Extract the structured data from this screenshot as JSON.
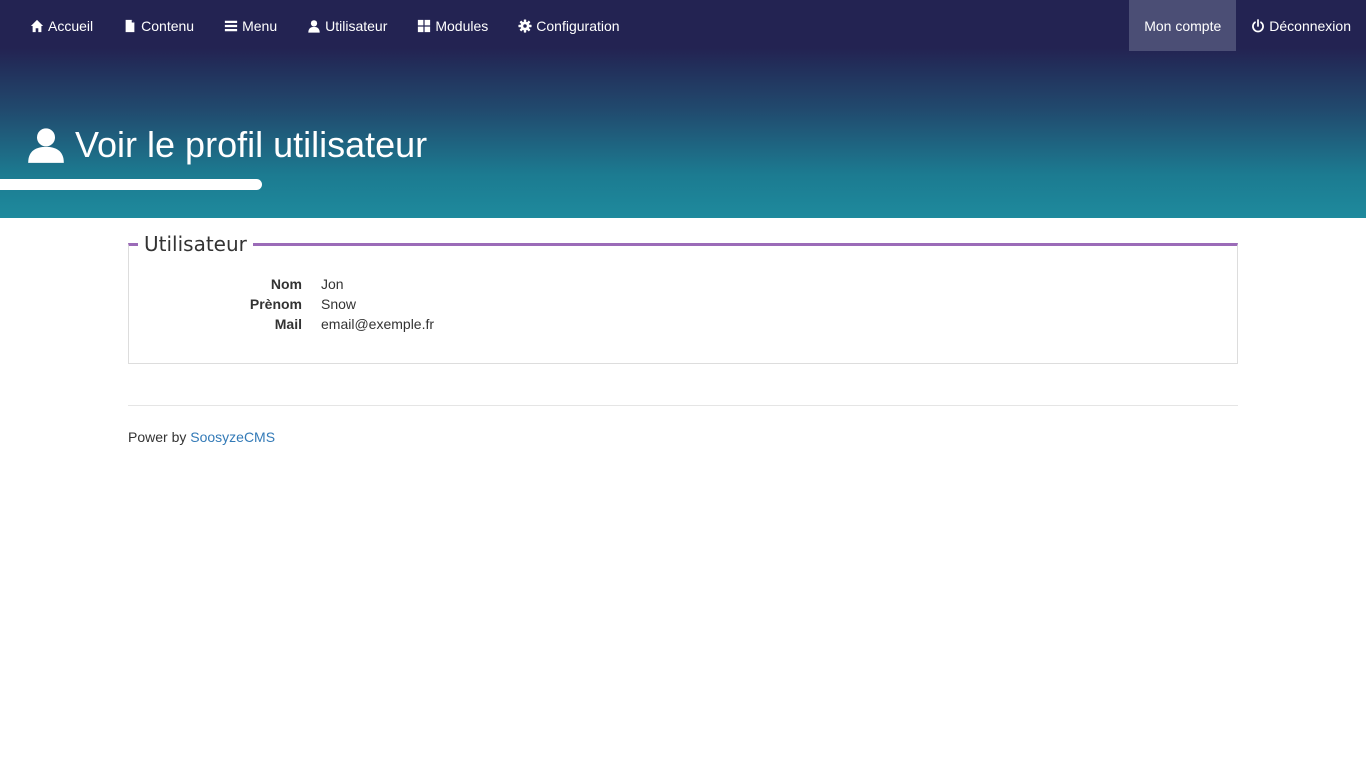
{
  "nav": {
    "left": [
      {
        "label": "Accueil",
        "icon": "home-icon"
      },
      {
        "label": "Contenu",
        "icon": "file-icon"
      },
      {
        "label": "Menu",
        "icon": "menu-icon"
      },
      {
        "label": "Utilisateur",
        "icon": "user-icon"
      },
      {
        "label": "Modules",
        "icon": "modules-icon"
      },
      {
        "label": "Configuration",
        "icon": "gear-icon"
      }
    ],
    "right": [
      {
        "label": "Mon compte"
      },
      {
        "label": "Déconnexion",
        "icon": "power-icon"
      }
    ]
  },
  "page": {
    "title": "Voir le profil utilisateur",
    "icon": "user-icon"
  },
  "profile": {
    "legend": "Utilisateur",
    "fields": [
      {
        "label": "Nom",
        "value": "Jon"
      },
      {
        "label": "Prènom",
        "value": "Snow"
      },
      {
        "label": "Mail",
        "value": "email@exemple.fr"
      }
    ]
  },
  "footer": {
    "text": "Power by",
    "link": "SoosyzeCMS"
  },
  "colors": {
    "header_top": "#232352",
    "header_bottom": "#1e8a9d",
    "legend_accent": "#9b6bb8",
    "link": "#337ab7"
  }
}
